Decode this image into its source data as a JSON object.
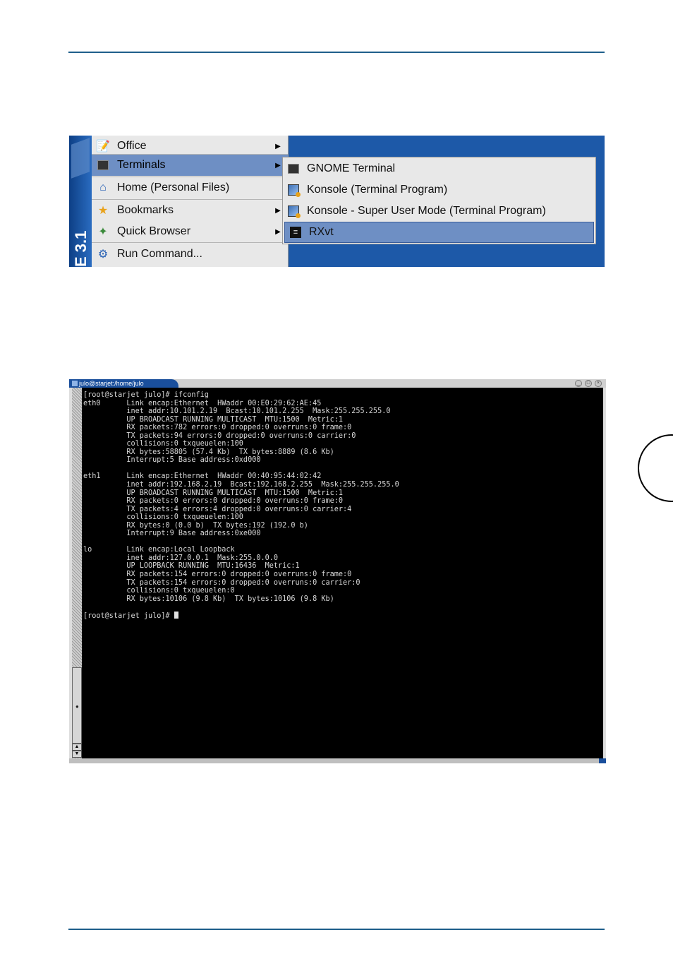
{
  "menu": {
    "kde_label": "E 3.1",
    "items": [
      {
        "label": "Office",
        "icon": "office-icon",
        "submenu": true
      },
      {
        "label": "Terminals",
        "icon": "terminal-icon",
        "submenu": true,
        "active": true
      },
      {
        "label": "Home (Personal Files)",
        "icon": "home-icon",
        "submenu": false
      },
      {
        "label": "Bookmarks",
        "icon": "star-icon",
        "submenu": true
      },
      {
        "label": "Quick Browser",
        "icon": "quick-browser-icon",
        "submenu": true
      },
      {
        "label": "Run Command...",
        "icon": "run-command-icon",
        "submenu": false
      }
    ],
    "submenu_items": [
      {
        "label": "GNOME Terminal",
        "icon": "gnome-terminal-icon"
      },
      {
        "label": "Konsole (Terminal Program)",
        "icon": "konsole-icon"
      },
      {
        "label": "Konsole - Super User Mode (Terminal Program)",
        "icon": "konsole-su-icon"
      },
      {
        "label": "RXvt",
        "icon": "rxvt-icon",
        "active": true
      }
    ],
    "colors": {
      "desktop": "#1d59a8",
      "highlight": "#6e8fc4",
      "menu_bg": "#e8e8e8"
    }
  },
  "terminal": {
    "tab_title": "julo@starjet:/home/julo",
    "prompt_final": "[root@starjet julo]# ",
    "lines": [
      "[root@starjet julo]# ifconfig",
      "eth0      Link encap:Ethernet  HWaddr 00:E0:29:62:AE:45",
      "          inet addr:10.101.2.19  Bcast:10.101.2.255  Mask:255.255.255.0",
      "          UP BROADCAST RUNNING MULTICAST  MTU:1500  Metric:1",
      "          RX packets:782 errors:0 dropped:0 overruns:0 frame:0",
      "          TX packets:94 errors:0 dropped:0 overruns:0 carrier:0",
      "          collisions:0 txqueuelen:100",
      "          RX bytes:58805 (57.4 Kb)  TX bytes:8889 (8.6 Kb)",
      "          Interrupt:5 Base address:0xd000",
      "",
      "eth1      Link encap:Ethernet  HWaddr 00:40:95:44:02:42",
      "          inet addr:192.168.2.19  Bcast:192.168.2.255  Mask:255.255.255.0",
      "          UP BROADCAST RUNNING MULTICAST  MTU:1500  Metric:1",
      "          RX packets:0 errors:0 dropped:0 overruns:0 frame:0",
      "          TX packets:4 errors:4 dropped:0 overruns:0 carrier:4",
      "          collisions:0 txqueuelen:100",
      "          RX bytes:0 (0.0 b)  TX bytes:192 (192.0 b)",
      "          Interrupt:9 Base address:0xe000",
      "",
      "lo        Link encap:Local Loopback",
      "          inet addr:127.0.0.1  Mask:255.0.0.0",
      "          UP LOOPBACK RUNNING  MTU:16436  Metric:1",
      "          RX packets:154 errors:0 dropped:0 overruns:0 frame:0",
      "          TX packets:154 errors:0 dropped:0 overruns:0 carrier:0",
      "          collisions:0 txqueuelen:0",
      "          RX bytes:10106 (9.8 Kb)  TX bytes:10106 (9.8 Kb)",
      ""
    ],
    "colors": {
      "background": "#000000",
      "foreground": "#d8d8d8",
      "tab": "#1a4f9c"
    }
  },
  "page": {
    "rule_color": "#1f5f8b"
  }
}
